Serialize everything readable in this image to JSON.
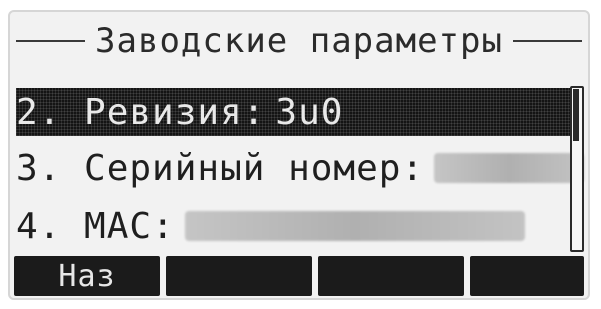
{
  "screen": {
    "title": "Заводские параметры",
    "items": [
      {
        "label": "2. Ревизия:",
        "value": "3u0"
      },
      {
        "label": "3. Серийный номер:",
        "value": ""
      },
      {
        "label": "4. MAC:",
        "value": ""
      }
    ],
    "softkeys": [
      "Наз",
      "",
      "",
      ""
    ]
  }
}
